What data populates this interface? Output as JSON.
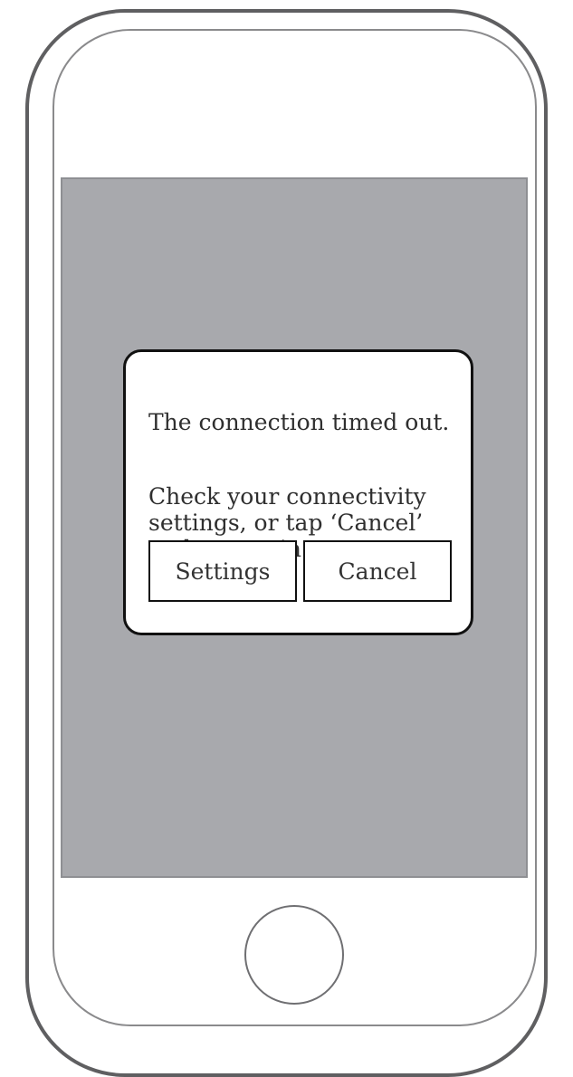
{
  "dialog": {
    "title": "The connection timed out.",
    "message": "Check your connectivity\nsettings, or tap ‘Cancel’\nand try again.",
    "buttons": {
      "settings": "Settings",
      "cancel": "Cancel"
    }
  },
  "device": {
    "home_button_icon": "home-button-icon"
  },
  "colors": {
    "screen_gray": "#a8a9ad",
    "dialog_background": "#ffffff",
    "outline_dark": "#111111"
  }
}
